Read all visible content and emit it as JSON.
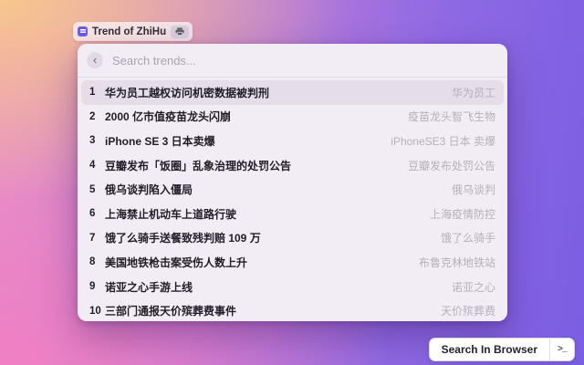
{
  "launcher_pill": {
    "label": "Trend of ZhiHu"
  },
  "search": {
    "placeholder": "Search trends...",
    "back_glyph": "‹"
  },
  "trends": {
    "items": [
      {
        "rank": "1",
        "title": "华为员工越权访问机密数据被判刑",
        "tag": "华为员工"
      },
      {
        "rank": "2",
        "title": "2000 亿市值疫苗龙头闪崩",
        "tag": "疫苗龙头智飞生物"
      },
      {
        "rank": "3",
        "title": "iPhone SE 3 日本卖爆",
        "tag": "iPhoneSE3 日本 卖爆"
      },
      {
        "rank": "4",
        "title": "豆瓣发布「饭圈」乱象治理的处罚公告",
        "tag": "豆瓣发布处罚公告"
      },
      {
        "rank": "5",
        "title": "俄乌谈判陷入僵局",
        "tag": "俄乌谈判"
      },
      {
        "rank": "6",
        "title": "上海禁止机动车上道路行驶",
        "tag": "上海疫情防控"
      },
      {
        "rank": "7",
        "title": "饿了么骑手送餐致残判赔 109 万",
        "tag": "饿了么骑手"
      },
      {
        "rank": "8",
        "title": "美国地铁枪击案受伤人数上升",
        "tag": "布鲁克林地铁站"
      },
      {
        "rank": "9",
        "title": "诺亚之心手游上线",
        "tag": "诺亚之心"
      },
      {
        "rank": "10",
        "title": "三部门通报天价殡葬费事件",
        "tag": "天价殡葬费"
      }
    ]
  },
  "footer": {
    "browser_button_label": "Search In Browser",
    "terminal_glyph": ">_"
  },
  "colors": {
    "accent_purple": "#6d5ae6",
    "wallpaper_peach": "#f7c68e",
    "wallpaper_pink": "#f07fc4",
    "wallpaper_purple": "#7a5ee2",
    "panel_bg": "#f2edf4",
    "selected_row_bg": "#e5dee9",
    "tag_text": "#b6aebc"
  }
}
